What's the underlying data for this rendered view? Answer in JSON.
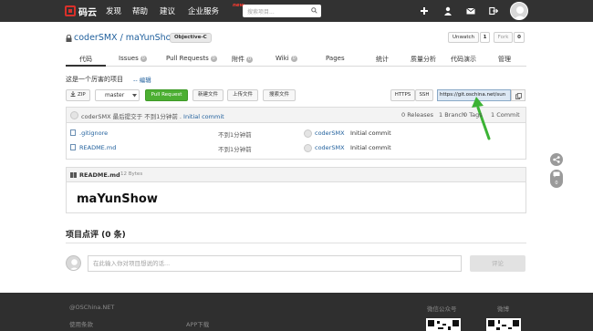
{
  "topbar": {
    "logo_text": "码云",
    "nav": [
      "发现",
      "帮助",
      "建议",
      "企业服务"
    ],
    "new_badge": "new",
    "search_placeholder": "搜索项目..."
  },
  "repo": {
    "title": "coderSMX / maYunShow",
    "language": "Objective-C",
    "watch_label": "Unwatch",
    "watch_count": "1",
    "fork_label": "Fork",
    "fork_count": "0"
  },
  "tabs": [
    {
      "label": "代码",
      "badge": ""
    },
    {
      "label": "Issues",
      "badge": "0"
    },
    {
      "label": "Pull Requests",
      "badge": "0"
    },
    {
      "label": "附件",
      "badge": "0"
    },
    {
      "label": "Wiki",
      "badge": "0"
    },
    {
      "label": "Pages",
      "badge": ""
    },
    {
      "label": "统计",
      "badge": ""
    },
    {
      "label": "质量分析",
      "badge": ""
    },
    {
      "label": "代码演示",
      "badge": ""
    },
    {
      "label": "管理",
      "badge": ""
    }
  ],
  "description": {
    "text": "这是一个厉害的项目",
    "edit_label": "编辑"
  },
  "toolbar": {
    "zip_label": "ZIP",
    "branch": "master",
    "pull_request_label": "Pull Request",
    "new_file_label": "新建文件",
    "upload_file_label": "上传文件",
    "search_file_label": "搜索文件",
    "https_label": "HTTPS",
    "ssh_label": "SSH",
    "clone_url": "https://git.oschina.net/sun"
  },
  "commit": {
    "user": "coderSMX",
    "text": "最后提交于 不到1分钟前 .",
    "message": "Initial commit",
    "releases": "0 Releases",
    "branches": "1 Branch",
    "tags": "0 Tags",
    "commits": "1 Commit"
  },
  "files": [
    {
      "name": ".gitignore",
      "time": "不到1分钟前",
      "user": "coderSMX",
      "message": "Initial commit"
    },
    {
      "name": "README.md",
      "time": "不到1分钟前",
      "user": "coderSMX",
      "message": "Initial commit"
    }
  ],
  "readme": {
    "file": "README.md",
    "size": "12 Bytes",
    "heading": "maYunShow"
  },
  "side": {
    "comment_count": "0"
  },
  "comments": {
    "title": "项目点评 (0 条)",
    "placeholder": "在此输入你对项目想说的话...",
    "submit_label": "评论"
  },
  "footer": {
    "copyright": "@OSChina.NET",
    "terms": "使用条款",
    "app": "APP下载",
    "wechat": "微信公众号",
    "weibo": "微博"
  },
  "colors": {
    "topbar": "#323232",
    "brand_red": "#d9302a",
    "link_blue": "#1f5f9c",
    "pr_green": "#4caf32",
    "arrow_green": "#3cb335"
  }
}
